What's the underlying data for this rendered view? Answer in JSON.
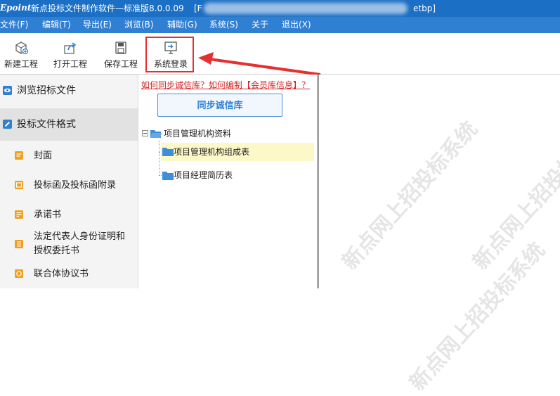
{
  "titlebar": {
    "logo": "Epoint",
    "app_title": "新点投标文件制作软件—标准版8.0.0.09",
    "path_start": "[F",
    "path_end": "etbp]"
  },
  "menubar": {
    "items": [
      "文件(F)",
      "编辑(T)",
      "导出(E)",
      "浏览(B)",
      "辅助(G)",
      "系统(S)",
      "关于",
      "退出(X)"
    ]
  },
  "toolbar": {
    "new_project": "新建工程",
    "open_project": "打开工程",
    "save_project": "保存工程",
    "system_login": "系统登录"
  },
  "sidebar": {
    "browse_tender": "浏览招标文件",
    "bid_format": "投标文件格式",
    "items": [
      {
        "label": "封面"
      },
      {
        "label": "投标函及投标函附录"
      },
      {
        "label": "承诺书"
      },
      {
        "label": "法定代表人身份证明和",
        "label2": "授权委托书"
      },
      {
        "label": "联合体协议书"
      }
    ]
  },
  "main": {
    "help_links": "如何同步诚信库？如何编制【会员库信息】？",
    "sync_button": "同步诚信库",
    "tree": {
      "root": "项目管理机构资料",
      "children": [
        "项目管理机构组成表",
        "项目经理简历表"
      ]
    }
  },
  "watermark": {
    "text": "新点网上招投标系统"
  },
  "colors": {
    "titlebar": "#1b6fc4",
    "menubar": "#2f7fd3",
    "highlight": "#e53030",
    "link": "#d42020",
    "selection": "#fdf8c8"
  }
}
